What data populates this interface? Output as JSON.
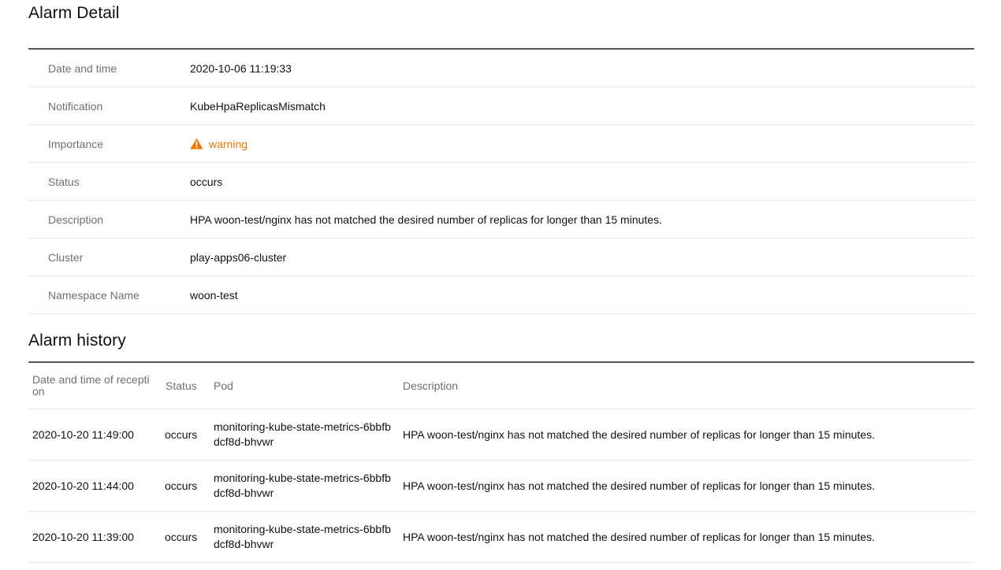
{
  "detail": {
    "title": "Alarm Detail",
    "rows": [
      {
        "label": "Date and time",
        "value": "2020-10-06 11:19:33"
      },
      {
        "label": "Notification",
        "value": "KubeHpaReplicasMismatch"
      },
      {
        "label": "Importance",
        "value": "warning"
      },
      {
        "label": "Status",
        "value": "occurs"
      },
      {
        "label": "Description",
        "value": "HPA woon-test/nginx has not matched the desired number of replicas for longer than 15 minutes."
      },
      {
        "label": "Cluster",
        "value": "play-apps06-cluster"
      },
      {
        "label": "Namespace Name",
        "value": "woon-test"
      }
    ],
    "importance_icon": "warning-triangle-icon",
    "importance_color": "#f07800"
  },
  "history": {
    "title": "Alarm history",
    "columns": {
      "date": "Date and time of reception",
      "status": "Status",
      "pod": "Pod",
      "description": "Description"
    },
    "rows": [
      {
        "date": "2020-10-20 11:49:00",
        "status": "occurs",
        "pod": "monitoring-kube-state-metrics-6bbfbdcf8d-bhvwr",
        "description": "HPA woon-test/nginx has not matched the desired number of replicas for longer than 15 minutes."
      },
      {
        "date": "2020-10-20 11:44:00",
        "status": "occurs",
        "pod": "monitoring-kube-state-metrics-6bbfbdcf8d-bhvwr",
        "description": "HPA woon-test/nginx has not matched the desired number of replicas for longer than 15 minutes."
      },
      {
        "date": "2020-10-20 11:39:00",
        "status": "occurs",
        "pod": "monitoring-kube-state-metrics-6bbfbdcf8d-bhvwr",
        "description": "HPA woon-test/nginx has not matched the desired number of replicas for longer than 15 minutes."
      }
    ]
  }
}
